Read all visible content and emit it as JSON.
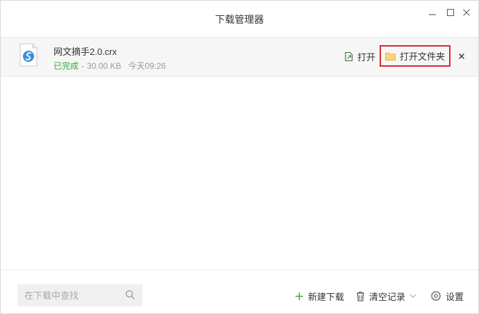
{
  "window": {
    "title": "下载管理器"
  },
  "download": {
    "file_name": "网文摘手2.0.crx",
    "status": "已完成",
    "separator": "-",
    "size": "30.00 KB",
    "time": "今天09:26",
    "open_label": "打开",
    "open_folder_label": "打开文件夹"
  },
  "footer": {
    "search_placeholder": "在下载中查找",
    "new_download_label": "新建下载",
    "clear_records_label": "清空记录",
    "settings_label": "设置"
  },
  "icons": {
    "app": "minimize-icon, maximize-icon, close-icon",
    "file": "crx-file-icon",
    "open": "open-file-icon",
    "folder": "folder-icon",
    "search": "search-icon",
    "new": "plus-icon",
    "clear": "trash-icon",
    "settings": "gear-icon"
  },
  "colors": {
    "status_done": "#3aa83a",
    "highlight_border": "#e0262b",
    "new_download_plus": "#3aa83a",
    "folder": "#f5c542"
  }
}
